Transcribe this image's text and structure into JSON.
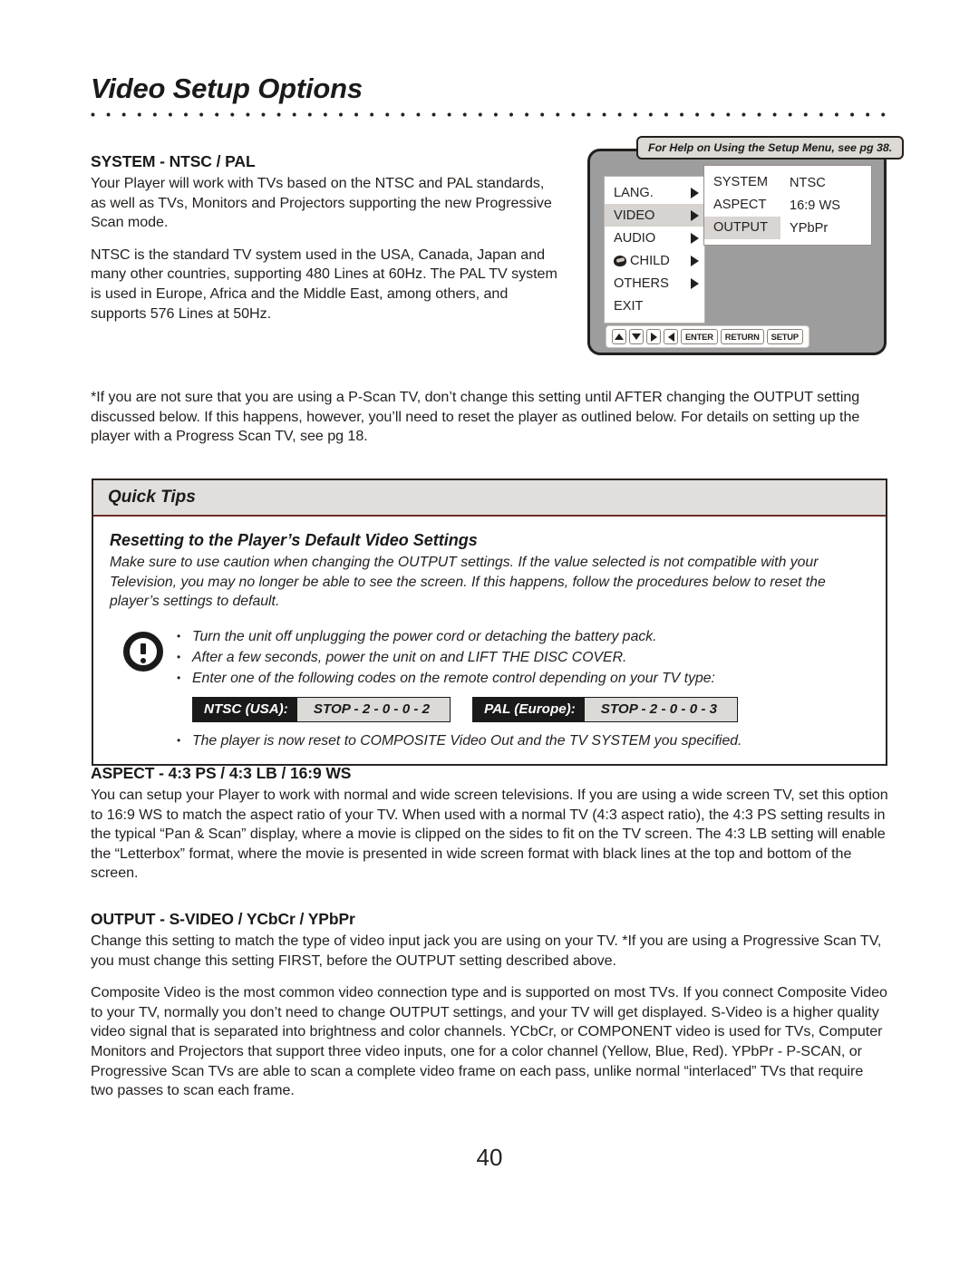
{
  "page": {
    "title": "Video Setup Options",
    "number": "40"
  },
  "system_section": {
    "heading": "SYSTEM - NTSC / PAL",
    "paragraph1": "Your Player will work with TVs based on the NTSC and PAL standards, as well as TVs, Monitors and Projectors supporting the new Progressive Scan mode.",
    "paragraph2": "NTSC is the standard TV system used in the USA, Canada, Japan and many other countries, supporting 480 Lines at 60Hz. The PAL TV system is used in Europe, Africa and the Middle East, among others, and supports 576 Lines at 50Hz."
  },
  "tv_diagram": {
    "tooltip": "For Help on Using the Setup Menu, see pg 38.",
    "menu_items": [
      {
        "label": "LANG.",
        "selected": false,
        "has_arrow": true,
        "icon": null
      },
      {
        "label": "VIDEO",
        "selected": true,
        "has_arrow": true,
        "icon": null
      },
      {
        "label": "AUDIO",
        "selected": false,
        "has_arrow": true,
        "icon": null
      },
      {
        "label": "CHILD",
        "selected": false,
        "has_arrow": true,
        "icon": "child-lock-icon"
      },
      {
        "label": "OTHERS",
        "selected": false,
        "has_arrow": true,
        "icon": null
      },
      {
        "label": "EXIT",
        "selected": false,
        "has_arrow": false,
        "icon": null
      }
    ],
    "submenu_rows": [
      {
        "key": "SYSTEM",
        "value": "NTSC",
        "selected": false
      },
      {
        "key": "ASPECT",
        "value": "16:9 WS",
        "selected": false
      },
      {
        "key": "OUTPUT",
        "value": "YPbPr",
        "selected": true
      }
    ],
    "nav_buttons": [
      {
        "type": "arrow",
        "direction": "up",
        "label": ""
      },
      {
        "type": "arrow",
        "direction": "down",
        "label": ""
      },
      {
        "type": "arrow",
        "direction": "right",
        "label": ""
      },
      {
        "type": "arrow",
        "direction": "left",
        "label": ""
      },
      {
        "type": "text",
        "direction": "",
        "label": "ENTER"
      },
      {
        "type": "text",
        "direction": "",
        "label": "RETURN"
      },
      {
        "type": "text",
        "direction": "",
        "label": "SETUP"
      }
    ]
  },
  "note": {
    "text": "*If you are not sure that you are using a P-Scan TV, don’t change this setting until AFTER changing the OUTPUT setting discussed below. If this happens, however, you’ll need to reset the player as outlined below. For details on setting up the player with a Progress Scan TV, see pg 18."
  },
  "quick_tips": {
    "header": "Quick Tips",
    "subtitle": "Resetting to the Player’s Default Video Settings",
    "intro": "Make sure to use caution when changing the OUTPUT settings. If the value selected is not compatible with your Television, you may no longer be able to see the screen. If this happens, follow the procedures below to reset the player’s settings to default.",
    "bullets_top": [
      "Turn the unit off unplugging the power cord or detaching the battery pack.",
      "After a few seconds, power the unit on and LIFT THE DISC COVER.",
      "Enter one of the following codes on the remote control depending on your TV type:"
    ],
    "codes": [
      {
        "label": "NTSC (USA):",
        "value": "STOP - 2 - 0 - 0 - 2"
      },
      {
        "label": "PAL (Europe):",
        "value": "STOP - 2 - 0 - 0 - 3"
      }
    ],
    "bullets_bottom": [
      "The player is now reset to COMPOSITE Video Out and the TV SYSTEM you specified."
    ],
    "bullet_char": "•"
  },
  "aspect_section": {
    "heading": "ASPECT - 4:3 PS / 4:3 LB / 16:9 WS",
    "paragraph": "You can setup your Player to work with normal and wide screen televisions. If you are using a wide screen TV, set this option to 16:9 WS to match the aspect ratio of your TV. When used with a normal TV (4:3 aspect ratio), the 4:3 PS setting results in the typical “Pan & Scan” display, where a movie is clipped on the sides to fit on the TV screen. The 4:3 LB setting will enable the “Letterbox” format, where the movie is presented in wide screen format with black lines at the top and bottom of the screen."
  },
  "output_section": {
    "heading": "OUTPUT - S-VIDEO / YCbCr / YPbPr",
    "paragraph1": "Change this setting to match the type of video input jack you are using on your TV. *If you are using a Progressive Scan TV, you must change this setting FIRST, before the OUTPUT setting described above.",
    "paragraph2": "Composite Video is the most common video connection type and is supported on most TVs. If you connect Composite Video to your TV, normally you don’t need to change OUTPUT settings, and your TV will get displayed. S-Video is a higher quality video signal that is separated into brightness and color channels. YCbCr, or COMPONENT video is used for TVs, Computer Monitors and Projectors that support three video inputs, one for a color channel (Yellow, Blue, Red). YPbPr - P-SCAN, or Progressive Scan TVs are able to scan a complete video frame on each pass, unlike normal “interlaced” TVs that require two passes to scan each frame."
  },
  "colors": {
    "text": "#231f1d",
    "tv_frame_bg": "#9d9d9d",
    "menu_highlight": "#d6d3d0",
    "quicktips_header_bg": "#e1dedb",
    "quicktips_divider": "#6d2f24",
    "code_label_bg": "#1a1a1a",
    "code_value_bg": "#dcdad7"
  }
}
